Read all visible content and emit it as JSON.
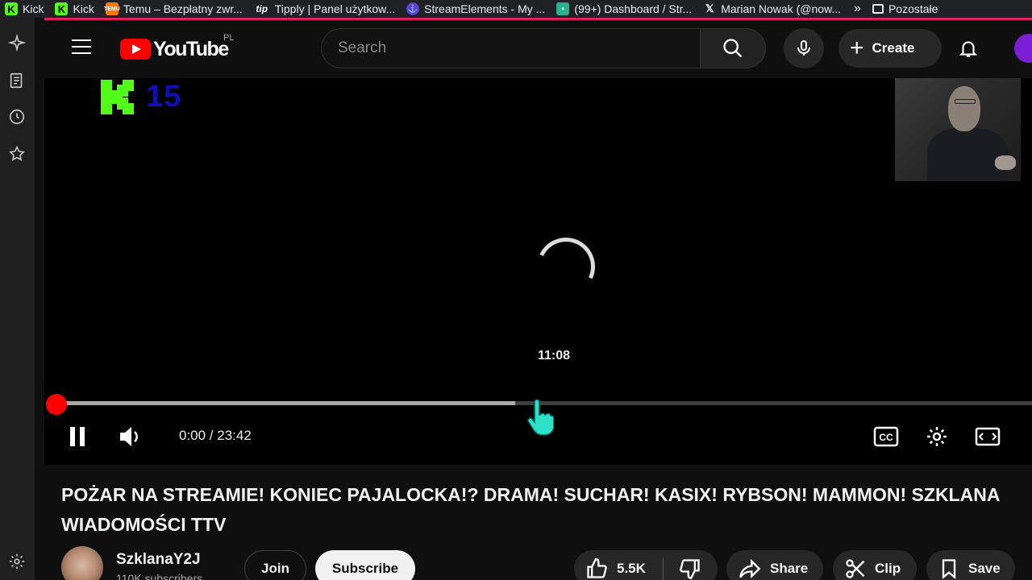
{
  "bookmarks": [
    {
      "label": "Kick",
      "icon": "kick-icon"
    },
    {
      "label": "Kick",
      "icon": "kick-icon"
    },
    {
      "label": "Temu – Bezpłatny zwr...",
      "icon": "temu-icon"
    },
    {
      "label": "Tipply | Panel użytkow...",
      "icon": "tipply-icon"
    },
    {
      "label": "StreamElements - My ...",
      "icon": "streamelements-icon"
    },
    {
      "label": "(99+) Dashboard / Str...",
      "icon": "dashboard-icon"
    },
    {
      "label": "Marian Nowak (@now...",
      "icon": "x-icon"
    }
  ],
  "bookmarks_folder": "Pozostałe",
  "colors": {
    "accent": "#ff0000",
    "kick_green": "#53fc18",
    "tab_indicator": "#e02060"
  },
  "header": {
    "logo_text": "YouTube",
    "country_code": "PL",
    "search_placeholder": "Search",
    "create_label": "Create"
  },
  "player": {
    "overlay_number": "15",
    "hover_time": "11:08",
    "current_time": "0:00",
    "duration": "23:42",
    "time_display": "0:00 / 23:42",
    "progress_fraction": 0.0,
    "hover_fraction": 0.47
  },
  "video": {
    "title_line1": "POŻAR NA STREAMIE! KONIEC PAJALOCKA!? DRAMA! SUCHAR! KASIX! RYBSON! MAMMON! SZKLANA",
    "title_line2": "WIADOMOŚCI TTV",
    "channel_name": "SzklanaY2J",
    "subscribers": "110K subscribers",
    "join_label": "Join",
    "subscribe_label": "Subscribe",
    "likes": "5.5K",
    "share_label": "Share",
    "clip_label": "Clip",
    "save_label": "Save"
  }
}
